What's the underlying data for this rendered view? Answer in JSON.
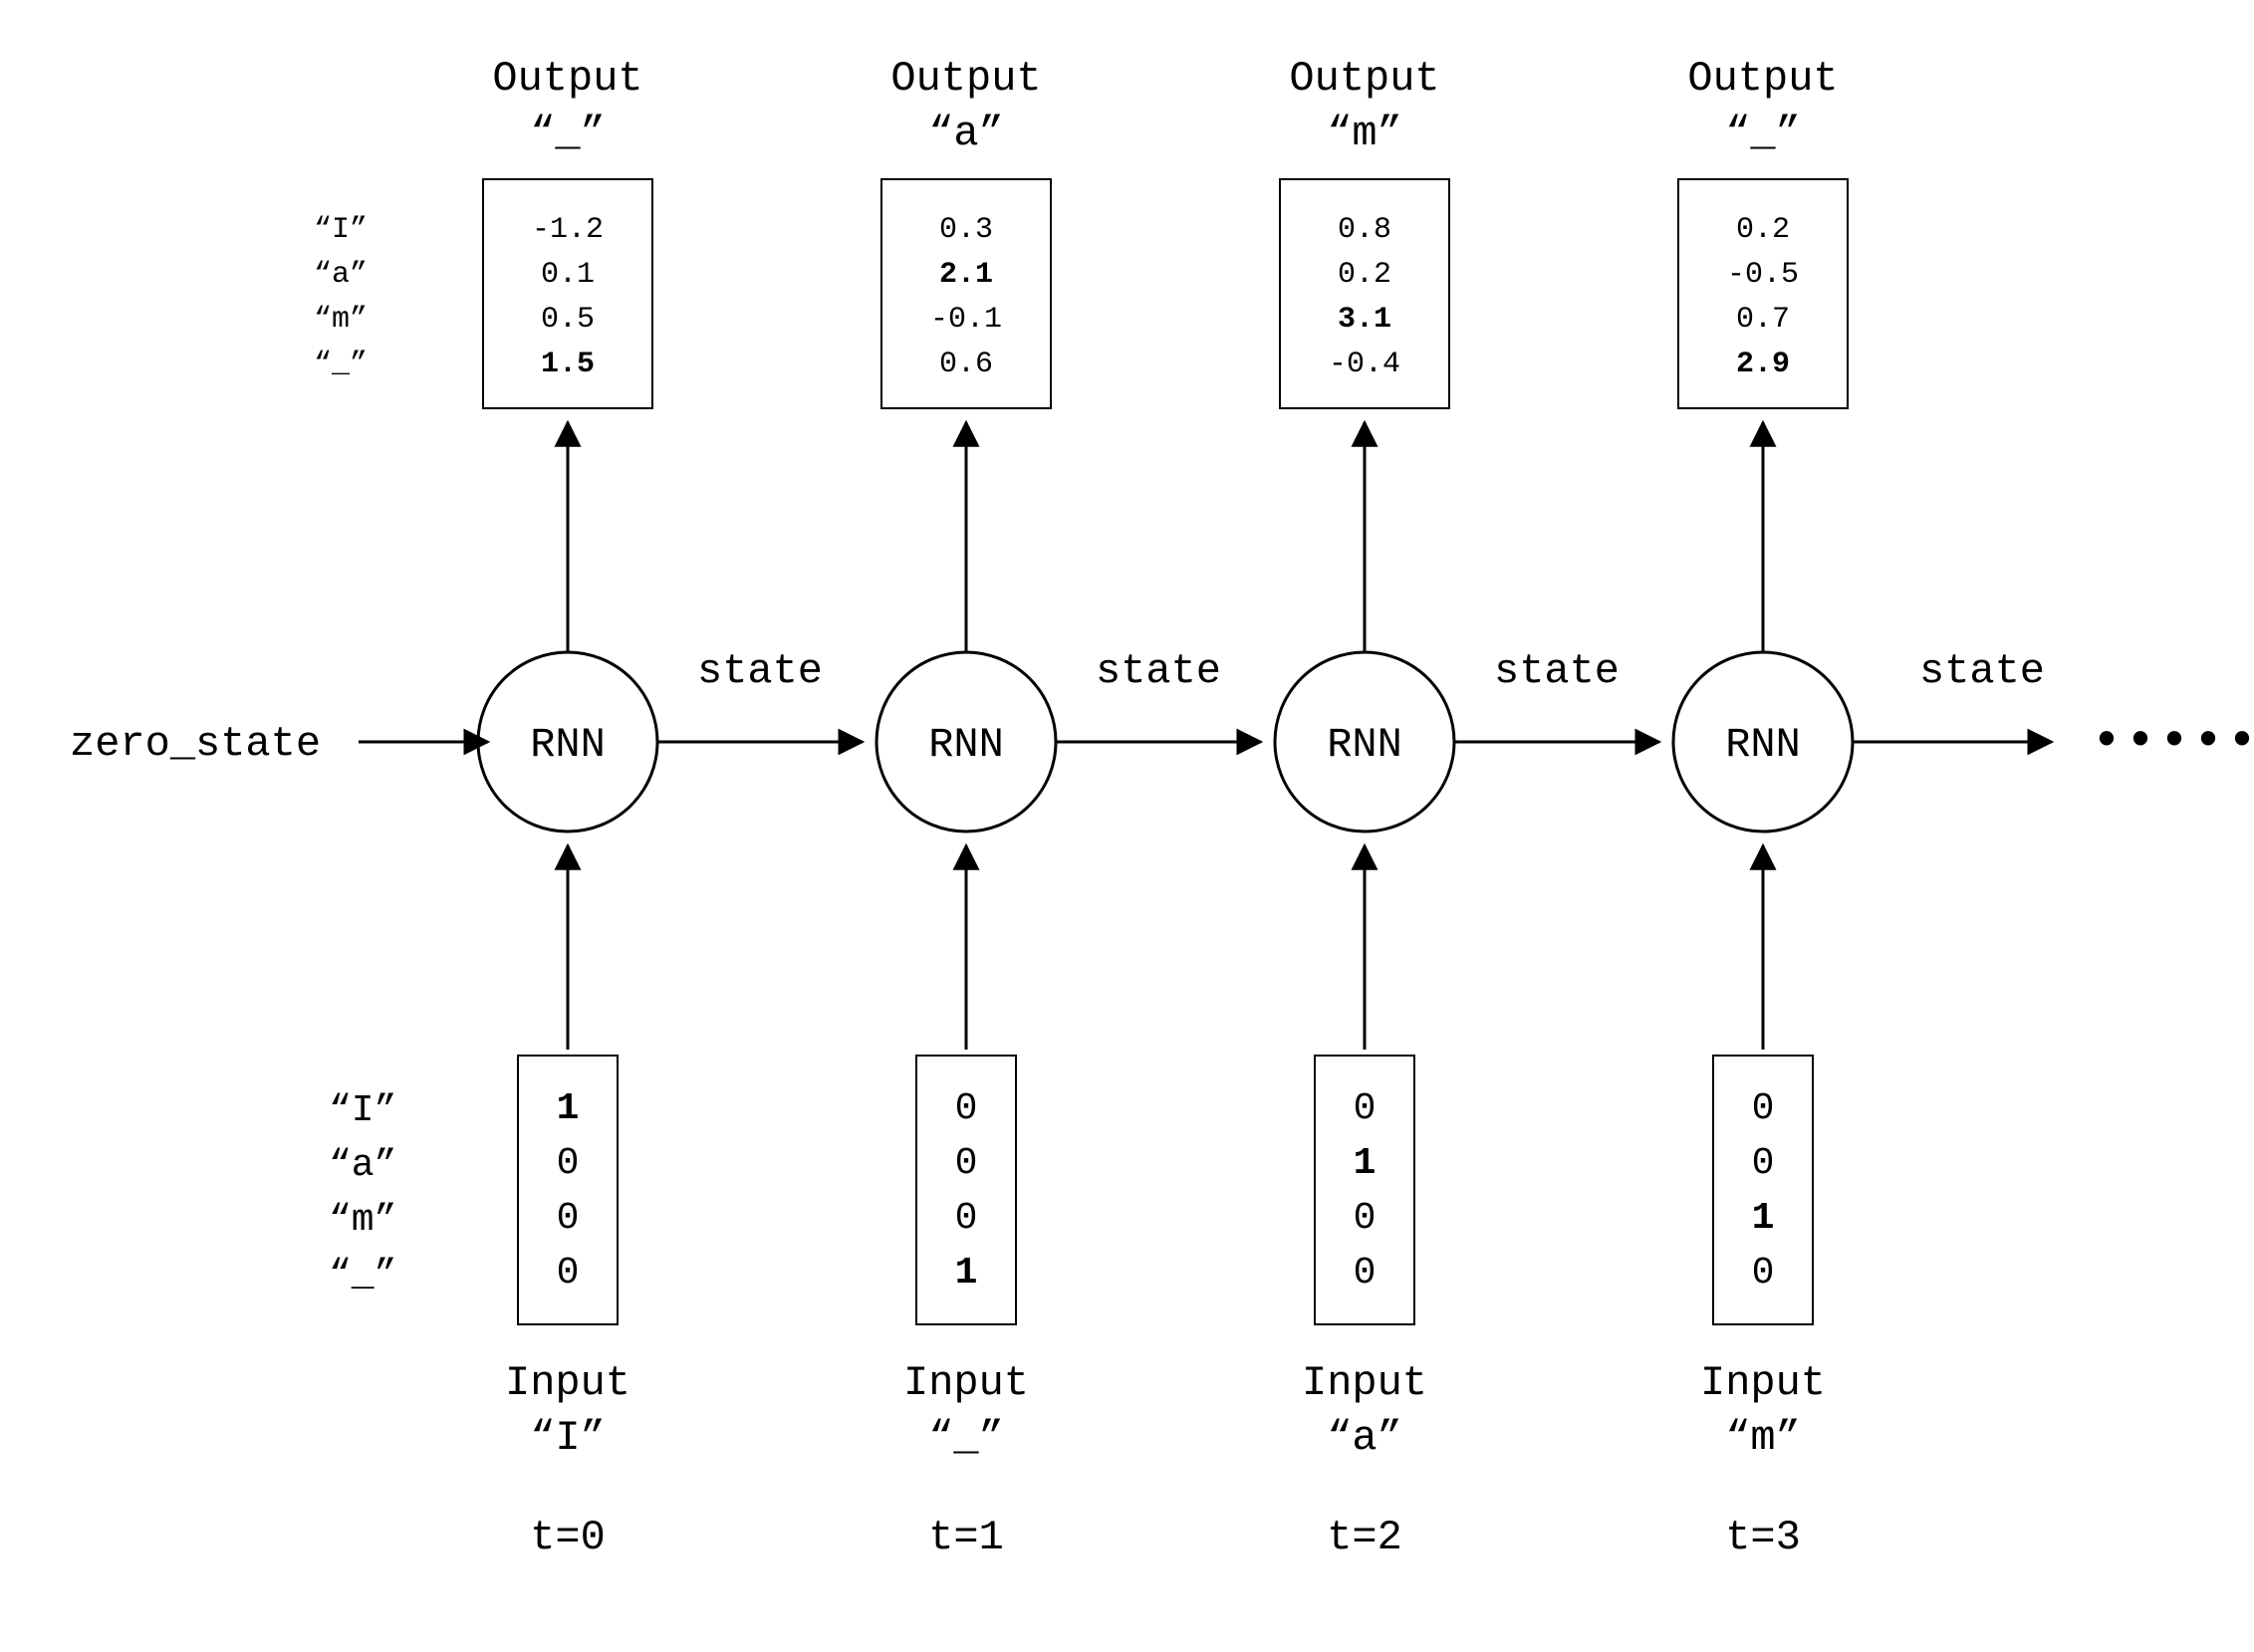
{
  "vocab_labels": [
    "“I”",
    "“a”",
    "“m”",
    "“_”"
  ],
  "zero_state_label": "zero_state",
  "state_label": "state",
  "continuation_dots": "••••••",
  "rnn_label": "RNN",
  "output_label": "Output",
  "input_label": "Input",
  "timesteps": [
    {
      "t_label": "t=0",
      "output_char": "“_”",
      "output_vec": [
        {
          "v": "-1.2",
          "bold": false
        },
        {
          "v": "0.1",
          "bold": false
        },
        {
          "v": "0.5",
          "bold": false
        },
        {
          "v": "1.5",
          "bold": true
        }
      ],
      "input_vec": [
        {
          "v": "1",
          "bold": true
        },
        {
          "v": "0",
          "bold": false
        },
        {
          "v": "0",
          "bold": false
        },
        {
          "v": "0",
          "bold": false
        }
      ],
      "input_char": "“I”"
    },
    {
      "t_label": "t=1",
      "output_char": "“a”",
      "output_vec": [
        {
          "v": "0.3",
          "bold": false
        },
        {
          "v": "2.1",
          "bold": true
        },
        {
          "v": "-0.1",
          "bold": false
        },
        {
          "v": "0.6",
          "bold": false
        }
      ],
      "input_vec": [
        {
          "v": "0",
          "bold": false
        },
        {
          "v": "0",
          "bold": false
        },
        {
          "v": "0",
          "bold": false
        },
        {
          "v": "1",
          "bold": true
        }
      ],
      "input_char": "“_”"
    },
    {
      "t_label": "t=2",
      "output_char": "“m”",
      "output_vec": [
        {
          "v": "0.8",
          "bold": false
        },
        {
          "v": "0.2",
          "bold": false
        },
        {
          "v": "3.1",
          "bold": true
        },
        {
          "v": "-0.4",
          "bold": false
        }
      ],
      "input_vec": [
        {
          "v": "0",
          "bold": false
        },
        {
          "v": "1",
          "bold": true
        },
        {
          "v": "0",
          "bold": false
        },
        {
          "v": "0",
          "bold": false
        }
      ],
      "input_char": "“a”"
    },
    {
      "t_label": "t=3",
      "output_char": "“_”",
      "output_vec": [
        {
          "v": "0.2",
          "bold": false
        },
        {
          "v": "-0.5",
          "bold": false
        },
        {
          "v": "0.7",
          "bold": false
        },
        {
          "v": "2.9",
          "bold": true
        }
      ],
      "input_vec": [
        {
          "v": "0",
          "bold": false
        },
        {
          "v": "0",
          "bold": false
        },
        {
          "v": "1",
          "bold": true
        },
        {
          "v": "0",
          "bold": false
        }
      ],
      "input_char": "“m”"
    }
  ]
}
